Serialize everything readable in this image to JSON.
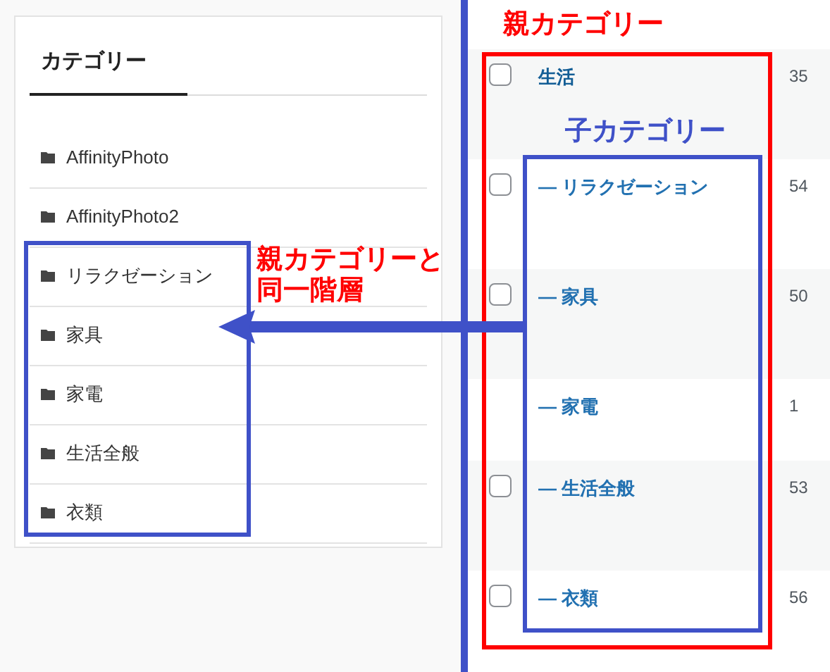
{
  "widget": {
    "title": "カテゴリー",
    "items": [
      {
        "label": "AffinityPhoto"
      },
      {
        "label": "AffinityPhoto2"
      },
      {
        "label": "リラクゼーション"
      },
      {
        "label": "家具"
      },
      {
        "label": "家電"
      },
      {
        "label": "生活全般"
      },
      {
        "label": "衣類"
      }
    ]
  },
  "category_table": {
    "rows": [
      {
        "name": "生活",
        "count": "35",
        "checked": false,
        "kind": "parent"
      },
      {
        "name": "— リラクゼーション",
        "count": "54",
        "checked": false,
        "kind": "child"
      },
      {
        "name": "— 家具",
        "count": "50",
        "checked": false,
        "kind": "child"
      },
      {
        "name": "— 家電",
        "count": "1",
        "kind": "child"
      },
      {
        "name": "— 生活全般",
        "count": "53",
        "checked": false,
        "kind": "child"
      },
      {
        "name": "— 衣類",
        "count": "56",
        "checked": false,
        "kind": "child"
      }
    ]
  },
  "annotations": {
    "parent_label": "親カテゴリー",
    "child_label": "子カテゴリー",
    "same_level_lines": [
      "親カテゴリーと",
      "同一階層"
    ]
  }
}
